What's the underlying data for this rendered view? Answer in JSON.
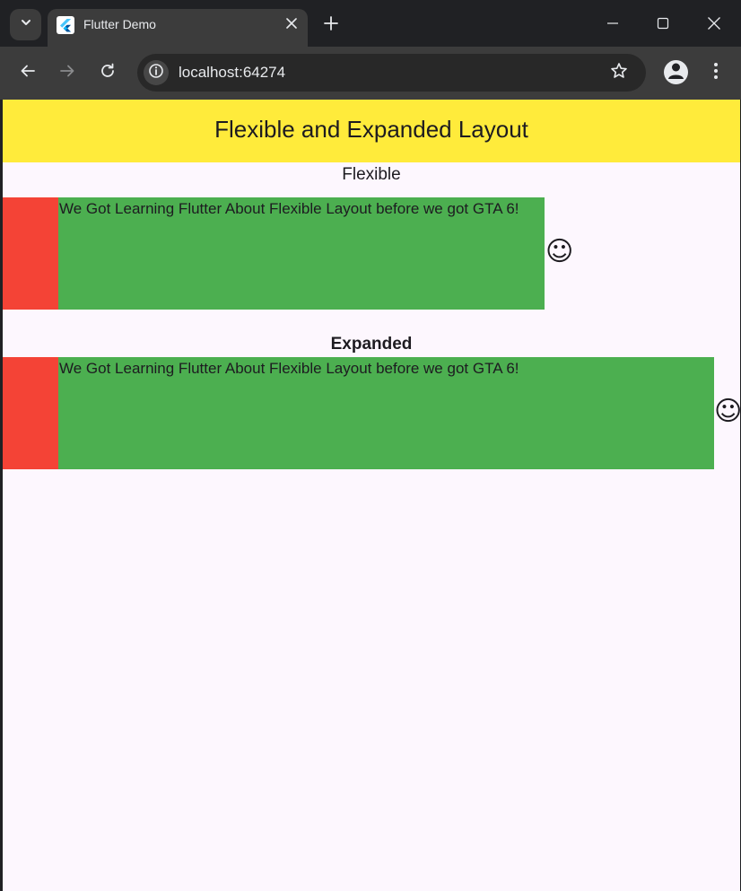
{
  "browser": {
    "tab": {
      "title": "Flutter Demo",
      "favicon": "flutter-icon"
    },
    "omnibox": {
      "url": "localhost:64274"
    }
  },
  "app": {
    "appbar_title": "Flexible and Expanded Layout",
    "colors": {
      "appbar": "#ffeb3b",
      "red_box": "#f44336",
      "green_box": "#4caf50",
      "background": "#fdf7fe"
    },
    "flexible_section": {
      "label": "Flexible",
      "text": "We Got Learning Flutter About Flexible Layout before we got GTA 6!",
      "trailing_icon": "☺"
    },
    "expanded_section": {
      "label": "Expanded",
      "text": "We Got Learning Flutter About Flexible Layout before we got GTA 6!",
      "trailing_icon": "☺"
    }
  }
}
